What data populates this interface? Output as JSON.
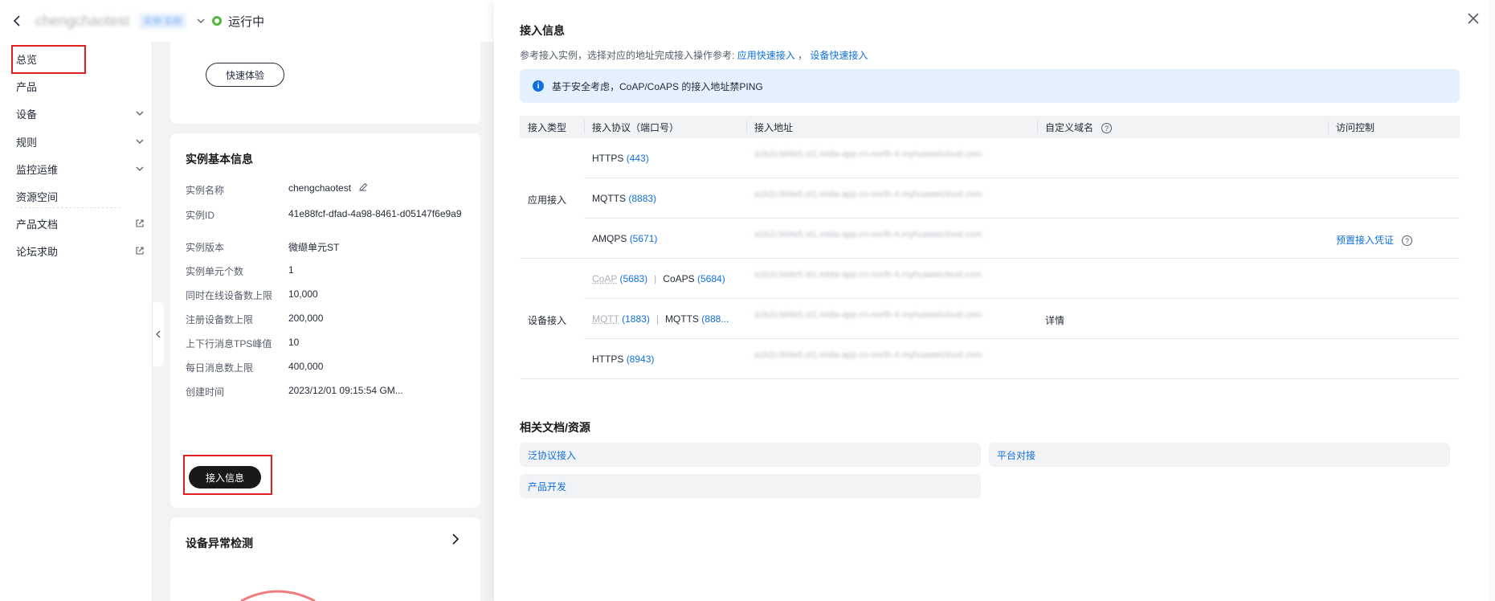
{
  "topbar": {
    "instance_name": "chengchaotest",
    "instance_tag": "实例 实例",
    "status": "运行中"
  },
  "sidebar": {
    "items": [
      {
        "label": "总览"
      },
      {
        "label": "产品"
      },
      {
        "label": "设备"
      },
      {
        "label": "规则"
      },
      {
        "label": "监控运维"
      },
      {
        "label": "资源空间"
      },
      {
        "label": "产品文档"
      },
      {
        "label": "论坛求助"
      }
    ]
  },
  "quick": {
    "button": "快速体验"
  },
  "instance_info": {
    "title": "实例基本信息",
    "rows": [
      {
        "key": "实例名称",
        "value": "chengchaotest"
      },
      {
        "key": "实例ID",
        "value": "41e88fcf-dfad-4a98-8461-d05147f6e9a9"
      },
      {
        "key": "实例版本",
        "value": "微缬单元ST"
      },
      {
        "key": "实例单元个数",
        "value": "1"
      },
      {
        "key": "同时在线设备数上限",
        "value": "10,000"
      },
      {
        "key": "注册设备数上限",
        "value": "200,000"
      },
      {
        "key": "上下行消息TPS峰值",
        "value": "10"
      },
      {
        "key": "每日消息数上限",
        "value": "400,000"
      },
      {
        "key": "创建时间",
        "value": "2023/12/01 09:15:54 GM..."
      }
    ],
    "access_button": "接入信息"
  },
  "anomaly": {
    "title": "设备异常检测"
  },
  "panel": {
    "title": "接入信息",
    "desc_prefix": "参考接入实例，选择对应的地址完成接入操作参考:",
    "link_app": "应用快速接入",
    "desc_sep": "，",
    "link_device": "设备快速接入",
    "alert": "基于安全考虑，CoAP/CoAPS 的接入地址禁PING",
    "headers": {
      "type": "接入类型",
      "protocol": "接入协议（端口号）",
      "address": "接入地址",
      "domain": "自定义域名",
      "access": "访问控制"
    },
    "app_type": "应用接入",
    "device_type": "设备接入",
    "rows": [
      {
        "proto": "HTTPS",
        "port": "(443)",
        "address": "a1b2c3d4e5.st1.iotda-app.cn-north-4.myhuaweicloud.com"
      },
      {
        "proto": "MQTTS",
        "port": "(8883)",
        "address": "a1b2c3d4e5.st1.iotda-app.cn-north-4.myhuaweicloud.com"
      },
      {
        "proto": "AMQPS",
        "port": "(5671)",
        "address": "a1b2c3d4e5.st1.iotda-app.cn-north-4.myhuaweicloud.com"
      },
      {
        "proto": "CoAP",
        "port": "(5683)",
        "proto2": "CoAPS",
        "port2": "(5684)",
        "address": "a1b2c3d4e5.st1.iotda-app.cn-north-4.myhuaweicloud.com"
      },
      {
        "proto": "MQTT",
        "port": "(1883)",
        "proto2": "MQTTS",
        "port2": "(888...",
        "address": "a1b2c3d4e5.st1.iotda-app.cn-north-4.myhuaweicloud.com"
      },
      {
        "proto": "HTTPS",
        "port": "(8943)",
        "address": "a1b2c3d4e5.st1.iotda-app.cn-north-4.myhuaweicloud.com"
      }
    ],
    "preset_credential": "预置接入凭证",
    "detail": "详情",
    "separator": "|",
    "resources_title": "相关文档/资源",
    "resources": [
      {
        "label": "泛协议接入"
      },
      {
        "label": "平台对接"
      },
      {
        "label": "产品开发"
      }
    ]
  },
  "colors": {
    "accent": "#0f6fde",
    "running": "#50b83c",
    "highlight": "#e02020"
  }
}
